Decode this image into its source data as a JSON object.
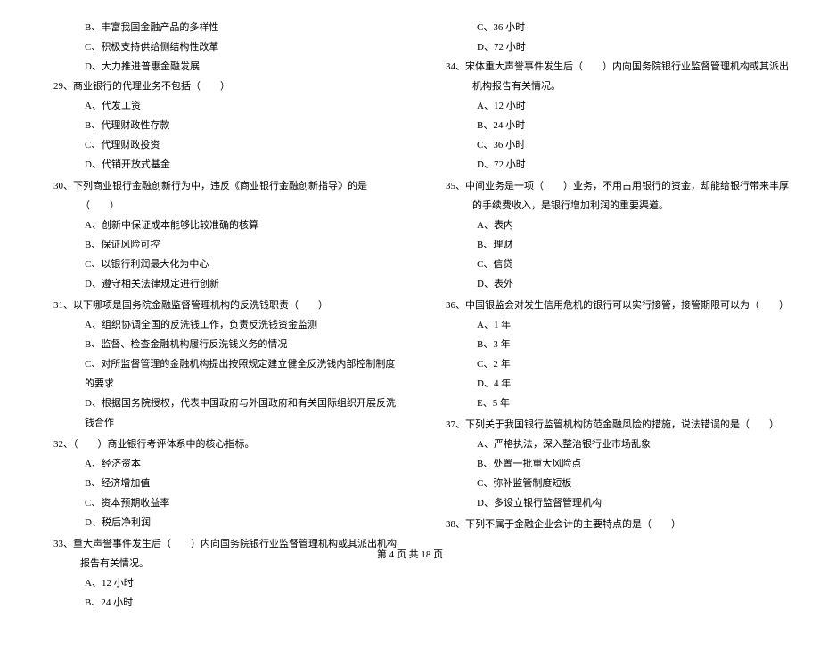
{
  "left_column": {
    "pre_options": [
      "B、丰富我国金融产品的多样性",
      "C、积极支持供给侧结构性改革",
      "D、大力推进普惠金融发展"
    ],
    "q29": {
      "text": "29、商业银行的代理业务不包括（　　）",
      "options": [
        "A、代发工资",
        "B、代理财政性存款",
        "C、代理财政投资",
        "D、代销开放式基金"
      ]
    },
    "q30": {
      "text": "30、下列商业银行金融创新行为中，违反《商业银行金融创新指导》的是（　　）",
      "options": [
        "A、创新中保证成本能够比较准确的核算",
        "B、保证风险可控",
        "C、以银行利润最大化为中心",
        "D、遵守相关法律规定进行创新"
      ]
    },
    "q31": {
      "text": "31、以下哪项是国务院金融监督管理机构的反洗钱职责（　　）",
      "options": [
        "A、组织协调全国的反洗钱工作，负责反洗钱资金监测",
        "B、监督、检查金融机构履行反洗钱义务的情况",
        "C、对所监督管理的金融机构提出按照规定建立健全反洗钱内部控制制度的要求",
        "D、根据国务院授权，代表中国政府与外国政府和有关国际组织开展反洗钱合作"
      ]
    },
    "q32": {
      "text": "32、（　　）商业银行考评体系中的核心指标。",
      "options": [
        "A、经济资本",
        "B、经济增加值",
        "C、资本预期收益率",
        "D、税后净利润"
      ]
    },
    "q33": {
      "text": "33、重大声誉事件发生后（　　）内向国务院银行业监督管理机构或其派出机构报告有关情况。",
      "options": [
        "A、12 小时",
        "B、24 小时"
      ]
    }
  },
  "right_column": {
    "pre_options": [
      "C、36 小时",
      "D、72 小时"
    ],
    "q34": {
      "text": "34、宋体重大声誉事件发生后（　　）内向国务院银行业监督管理机构或其派出机构报告有关情况。",
      "options": [
        "A、12 小时",
        "B、24 小时",
        "C、36 小时",
        "D、72 小时"
      ]
    },
    "q35": {
      "text": "35、中间业务是一项（　　）业务，不用占用银行的资金，却能给银行带来丰厚的手续费收入，是银行增加利润的重要渠道。",
      "options": [
        "A、表内",
        "B、理财",
        "C、信贷",
        "D、表外"
      ]
    },
    "q36": {
      "text": "36、中国银监会对发生信用危机的银行可以实行接管，接管期限可以为（　　）",
      "options": [
        "A、1 年",
        "B、3 年",
        "C、2 年",
        "D、4 年",
        "E、5 年"
      ]
    },
    "q37": {
      "text": "37、下列关于我国银行监管机构防范金融风险的措施，说法错误的是（　　）",
      "options": [
        "A、严格执法，深入整治银行业市场乱象",
        "B、处置一批重大风险点",
        "C、弥补监管制度短板",
        "D、多设立银行监督管理机构"
      ]
    },
    "q38": {
      "text": "38、下列不属于金融企业会计的主要特点的是（　　）"
    }
  },
  "footer": "第 4 页 共 18 页"
}
